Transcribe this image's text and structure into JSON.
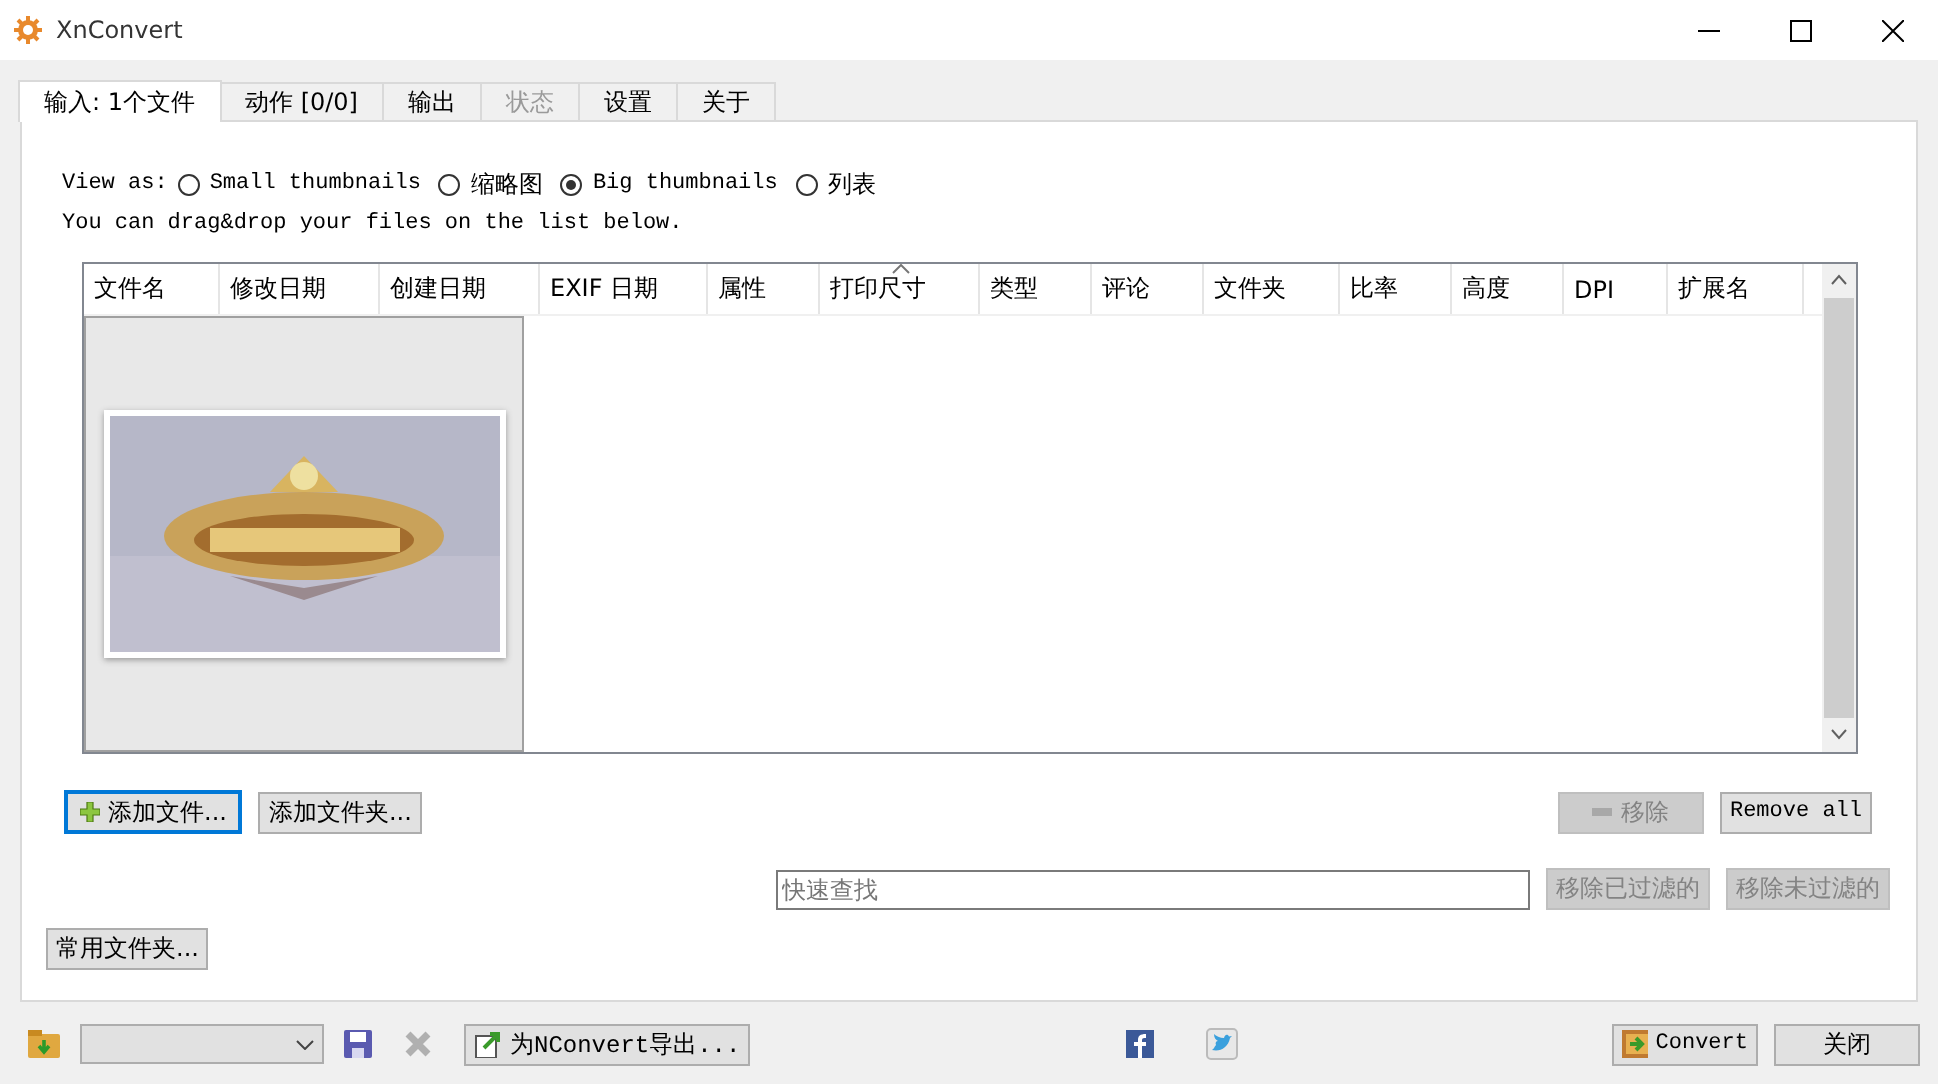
{
  "window": {
    "title": "XnConvert"
  },
  "tabs": [
    {
      "label": "输入: 1个文件",
      "selected": true,
      "disabled": false
    },
    {
      "label": "动作 [0/0]",
      "selected": false,
      "disabled": false
    },
    {
      "label": "输出",
      "selected": false,
      "disabled": false
    },
    {
      "label": "状态",
      "selected": false,
      "disabled": true
    },
    {
      "label": "设置",
      "selected": false,
      "disabled": false
    },
    {
      "label": "关于",
      "selected": false,
      "disabled": false
    }
  ],
  "view_as": {
    "label": "View as:",
    "options": [
      {
        "label": "Small thumbnails",
        "selected": false
      },
      {
        "label": "缩略图",
        "selected": false
      },
      {
        "label": "Big thumbnails",
        "selected": true
      },
      {
        "label": "列表",
        "selected": false
      }
    ]
  },
  "hint": "You can drag&drop your files on the list below.",
  "file_list": {
    "columns": [
      "文件名",
      "修改日期",
      "创建日期",
      "EXIF 日期",
      "属性",
      "打印尺寸",
      "类型",
      "评论",
      "文件夹",
      "比率",
      "高度",
      "DPI",
      "扩展名"
    ]
  },
  "add_files_button": {
    "label": "添加文件...",
    "focused": true
  },
  "add_folder_button": {
    "label": "添加文件夹..."
  },
  "remove_button": {
    "label": "移除",
    "disabled": true
  },
  "remove_all_button": {
    "label": "Remove all",
    "disabled": false
  },
  "search": {
    "placeholder": "快速查找"
  },
  "filter_buttons": [
    {
      "label": "移除已过滤的",
      "disabled": true
    },
    {
      "label": "移除未过滤的",
      "disabled": true
    }
  ],
  "favorites_button": {
    "label": "常用文件夹..."
  },
  "bottom_bar": {
    "export_button": "为NConvert导出...",
    "convert_button": "Convert",
    "close_button": "关闭"
  }
}
